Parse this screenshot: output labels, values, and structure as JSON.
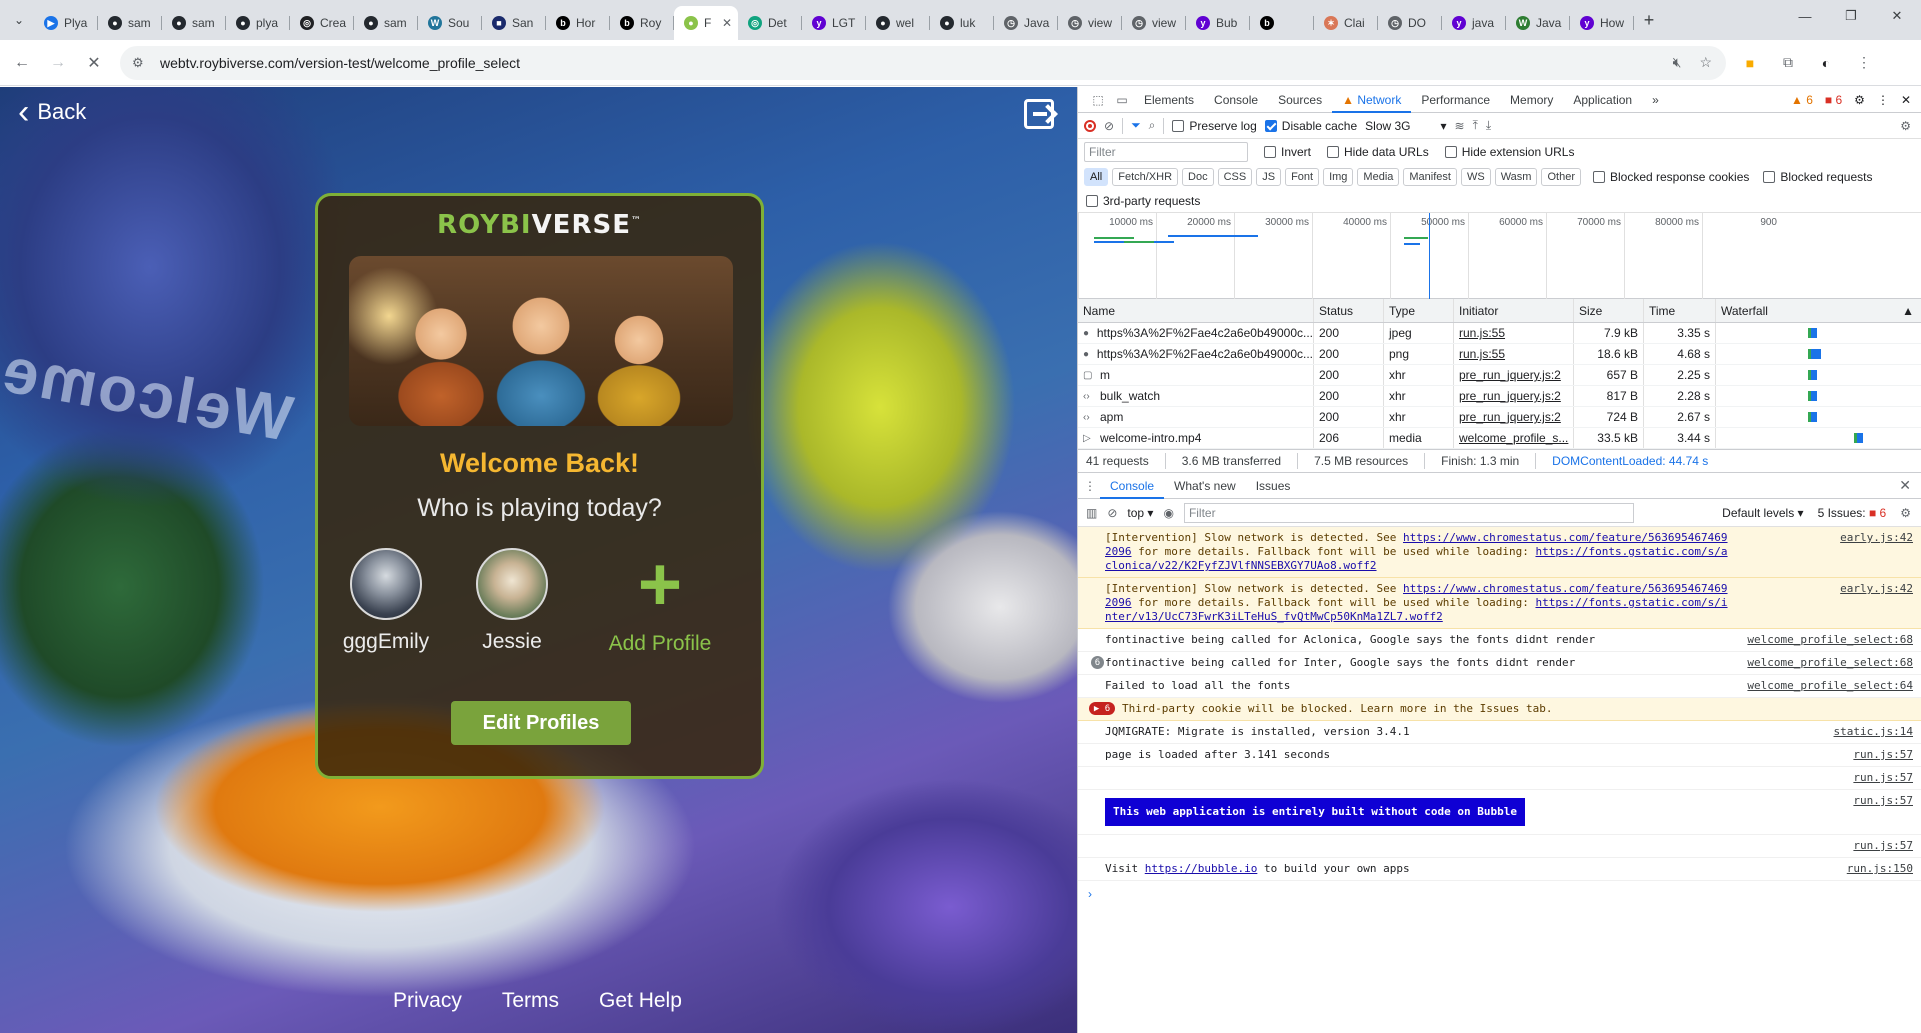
{
  "browser": {
    "tabs": [
      {
        "label": "Plya",
        "color": "#1a73e8",
        "glyph": "▶"
      },
      {
        "label": "sam",
        "color": "#24292f",
        "glyph": "●"
      },
      {
        "label": "sam",
        "color": "#24292f",
        "glyph": "●"
      },
      {
        "label": "plya",
        "color": "#24292f",
        "glyph": "●"
      },
      {
        "label": "Crea",
        "color": "#202124",
        "glyph": "◎"
      },
      {
        "label": "sam",
        "color": "#24292f",
        "glyph": "●"
      },
      {
        "label": "Sou",
        "color": "#21759b",
        "glyph": "W"
      },
      {
        "label": "San",
        "color": "#1a2a6c",
        "glyph": "■"
      },
      {
        "label": "Hor",
        "color": "#000000",
        "glyph": "b"
      },
      {
        "label": "Roy",
        "color": "#000000",
        "glyph": "b"
      },
      {
        "label": "F",
        "color": "#8bc34a",
        "glyph": "●",
        "active": true
      },
      {
        "label": "Det",
        "color": "#10a37f",
        "glyph": "◎"
      },
      {
        "label": "LGT",
        "color": "#6001d2",
        "glyph": "y"
      },
      {
        "label": "wel",
        "color": "#24292f",
        "glyph": "●"
      },
      {
        "label": "luk",
        "color": "#24292f",
        "glyph": "●"
      },
      {
        "label": "Java",
        "color": "#5f6368",
        "glyph": "◷"
      },
      {
        "label": "view",
        "color": "#5f6368",
        "glyph": "◷"
      },
      {
        "label": "view",
        "color": "#5f6368",
        "glyph": "◷"
      },
      {
        "label": "Bub",
        "color": "#6001d2",
        "glyph": "y"
      },
      {
        "label": "",
        "color": "#000000",
        "glyph": "b"
      },
      {
        "label": "Clai",
        "color": "#d97757",
        "glyph": "✶"
      },
      {
        "label": "DO",
        "color": "#5f6368",
        "glyph": "◷"
      },
      {
        "label": "java",
        "color": "#6001d2",
        "glyph": "y"
      },
      {
        "label": "Java",
        "color": "#2e7d32",
        "glyph": "W"
      },
      {
        "label": "How",
        "color": "#6001d2",
        "glyph": "y"
      }
    ],
    "new_tab": "+",
    "url": "webtv.roybiverse.com/version-test/welcome_profile_select"
  },
  "page": {
    "back_label": "Back",
    "welcome_deco": "Welcome",
    "brand_roybi": "ROYBI",
    "brand_verse": "VERSE",
    "brand_tm": "™",
    "welcome_title": "Welcome Back!",
    "subtitle": "Who is playing today?",
    "profiles": [
      {
        "name": "gggEmily"
      },
      {
        "name": "Jessie"
      }
    ],
    "add_profile_label": "Add Profile",
    "add_profile_glyph": "+",
    "edit_profiles_label": "Edit Profiles",
    "footer": [
      "Privacy",
      "Terms",
      "Get Help"
    ]
  },
  "devtools": {
    "tabs": [
      "Elements",
      "Console",
      "Sources",
      "Network",
      "Performance",
      "Memory",
      "Application"
    ],
    "active_tab": "Network",
    "more_tabs": "»",
    "warn_count": "6",
    "err_count": "6",
    "network": {
      "preserve_log": "Preserve log",
      "disable_cache": "Disable cache",
      "throttle": "Slow 3G",
      "filter_placeholder": "Filter",
      "invert": "Invert",
      "hide_data_urls": "Hide data URLs",
      "hide_ext_urls": "Hide extension URLs",
      "types": [
        "All",
        "Fetch/XHR",
        "Doc",
        "CSS",
        "JS",
        "Font",
        "Img",
        "Media",
        "Manifest",
        "WS",
        "Wasm",
        "Other"
      ],
      "blocked_cookies": "Blocked response cookies",
      "blocked_requests": "Blocked requests",
      "third_party": "3rd-party requests",
      "timeline_ticks": [
        "10000 ms",
        "20000 ms",
        "30000 ms",
        "40000 ms",
        "50000 ms",
        "60000 ms",
        "70000 ms",
        "80000 ms",
        "900"
      ],
      "columns": [
        "Name",
        "Status",
        "Type",
        "Initiator",
        "Size",
        "Time",
        "Waterfall"
      ],
      "rows": [
        {
          "icon": "●",
          "name": "https%3A%2F%2Fae4c2a6e0b49000c...",
          "status": "200",
          "type": "jpeg",
          "initiator": "run.js:55",
          "size": "7.9 kB",
          "time": "3.35 s"
        },
        {
          "icon": "●",
          "name": "https%3A%2F%2Fae4c2a6e0b49000c...",
          "status": "200",
          "type": "png",
          "initiator": "run.js:55",
          "size": "18.6 kB",
          "time": "4.68 s"
        },
        {
          "icon": "▢",
          "name": "m",
          "status": "200",
          "type": "xhr",
          "initiator": "pre_run_jquery.js:2",
          "size": "657 B",
          "time": "2.25 s"
        },
        {
          "icon": "‹›",
          "name": "bulk_watch",
          "status": "200",
          "type": "xhr",
          "initiator": "pre_run_jquery.js:2",
          "size": "817 B",
          "time": "2.28 s"
        },
        {
          "icon": "‹›",
          "name": "apm",
          "status": "200",
          "type": "xhr",
          "initiator": "pre_run_jquery.js:2",
          "size": "724 B",
          "time": "2.67 s"
        },
        {
          "icon": "▷",
          "name": "welcome-intro.mp4",
          "status": "206",
          "type": "media",
          "initiator": "welcome_profile_s...",
          "size": "33.5 kB",
          "time": "3.44 s"
        }
      ],
      "summary": {
        "requests": "41 requests",
        "transferred": "3.6 MB transferred",
        "resources": "7.5 MB resources",
        "finish": "Finish: 1.3 min",
        "dcl": "DOMContentLoaded: 44.74 s"
      }
    },
    "drawer": {
      "tabs": [
        "Console",
        "What's new",
        "Issues"
      ],
      "context": "top",
      "filter_placeholder": "Filter",
      "levels": "Default levels",
      "issues": "5 Issues:",
      "issues_count": "6",
      "messages": [
        {
          "kind": "warn",
          "text": "[Intervention] Slow network is detected. See ",
          "link": "https://www.chromestatus.com/feature/5636954674692096",
          "text2": " for more details. Fallback font will be used while loading: ",
          "link2": "https://fonts.gstatic.com/s/aclonica/v22/K2FyfZJVlfNNSEBXGY7UAo8.woff2",
          "src": "early.js:42"
        },
        {
          "kind": "warn",
          "text": "[Intervention] Slow network is detected. See ",
          "link": "https://www.chromestatus.com/feature/5636954674692096",
          "text2": " for more details. Fallback font will be used while loading: ",
          "link2": "https://fonts.gstatic.com/s/inter/v13/UcC73FwrK3iLTeHuS_fvQtMwCp50KnMa1ZL7.woff2",
          "src": "early.js:42"
        },
        {
          "kind": "log",
          "text": "fontinactive being called for Aclonica, Google says the fonts didnt render",
          "src": "welcome_profile_select:68"
        },
        {
          "kind": "log",
          "count": "6",
          "text": "fontinactive being called for Inter, Google says the fonts didnt render",
          "src": "welcome_profile_select:68"
        },
        {
          "kind": "log",
          "text": "Failed to load all the fonts",
          "src": "welcome_profile_select:64"
        },
        {
          "kind": "issue",
          "count": "▶ 6",
          "text": "Third-party cookie will be blocked. Learn more in the Issues tab."
        },
        {
          "kind": "log",
          "text": "JQMIGRATE: Migrate is installed, version 3.4.1",
          "src": "static.js:14"
        },
        {
          "kind": "log",
          "text": "page is loaded after 3.141 seconds",
          "src": "run.js:57"
        },
        {
          "kind": "log",
          "text": "",
          "src": "run.js:57"
        },
        {
          "kind": "banner",
          "text": "This web application is entirely built without code on Bubble",
          "src": "run.js:57"
        },
        {
          "kind": "log",
          "text": "",
          "src": "run.js:57"
        },
        {
          "kind": "log",
          "text": "Visit ",
          "link": "https://bubble.io",
          "text2": " to build your own apps",
          "src": "run.js:150"
        }
      ],
      "prompt": "›"
    }
  }
}
